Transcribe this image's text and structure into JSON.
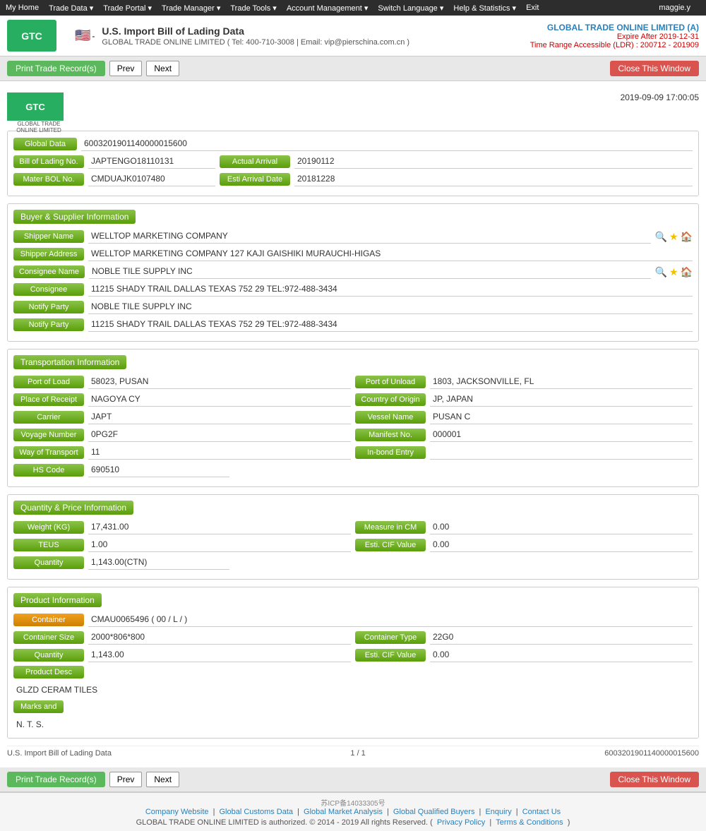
{
  "topnav": {
    "items": [
      "My Home",
      "Trade Data",
      "Trade Portal",
      "Trade Manager",
      "Trade Tools",
      "Account Management",
      "Switch Language",
      "Help & Statistics",
      "Exit"
    ],
    "user": "maggie.y"
  },
  "header": {
    "logo_text": "GTC",
    "logo_sub": "GLOBAL TRADE ONLINE LIMITED",
    "flag_emoji": "🇺🇸",
    "title": "U.S. Import Bill of Lading Data",
    "subtitle": "GLOBAL TRADE ONLINE LIMITED ( Tel: 400-710-3008 | Email: vip@pierschina.com.cn )",
    "company": "GLOBAL TRADE ONLINE LIMITED (A)",
    "expire": "Expire After 2019-12-31",
    "time_range": "Time Range Accessible (LDR) : 200712 - 201909"
  },
  "toolbar": {
    "print_label": "Print Trade Record(s)",
    "prev_label": "Prev",
    "next_label": "Next",
    "close_label": "Close This Window"
  },
  "record": {
    "timestamp": "2019-09-09 17:00:05",
    "global_data_label": "Global Data",
    "global_data_value": "6003201901140000015600",
    "bol_label": "Bill of Lading No.",
    "bol_value": "JAPTENGO18110131",
    "actual_arrival_label": "Actual Arrival",
    "actual_arrival_value": "20190112",
    "mater_bol_label": "Mater BOL No.",
    "mater_bol_value": "CMDUAJK0107480",
    "esti_arrival_label": "Esti Arrival Date",
    "esti_arrival_value": "20181228"
  },
  "buyer_supplier": {
    "section_title": "Buyer & Supplier Information",
    "shipper_name_label": "Shipper Name",
    "shipper_name_value": "WELLTOP MARKETING COMPANY",
    "shipper_address_label": "Shipper Address",
    "shipper_address_value": "WELLTOP MARKETING COMPANY 127 KAJI GAISHIKI MURAUCHI-HIGAS",
    "consignee_name_label": "Consignee Name",
    "consignee_name_value": "NOBLE TILE SUPPLY INC",
    "consignee_label": "Consignee",
    "consignee_value": "11215 SHADY TRAIL DALLAS TEXAS 752 29 TEL:972-488-3434",
    "notify_party_label": "Notify Party",
    "notify_party_value1": "NOBLE TILE SUPPLY INC",
    "notify_party_value2": "11215 SHADY TRAIL DALLAS TEXAS 752 29 TEL:972-488-3434"
  },
  "transport": {
    "section_title": "Transportation Information",
    "port_of_load_label": "Port of Load",
    "port_of_load_value": "58023, PUSAN",
    "port_of_unload_label": "Port of Unload",
    "port_of_unload_value": "1803, JACKSONVILLE, FL",
    "place_of_receipt_label": "Place of Receipt",
    "place_of_receipt_value": "NAGOYA CY",
    "country_of_origin_label": "Country of Origin",
    "country_of_origin_value": "JP, JAPAN",
    "carrier_label": "Carrier",
    "carrier_value": "JAPT",
    "vessel_name_label": "Vessel Name",
    "vessel_name_value": "PUSAN C",
    "voyage_number_label": "Voyage Number",
    "voyage_number_value": "0PG2F",
    "manifest_no_label": "Manifest No.",
    "manifest_no_value": "000001",
    "way_of_transport_label": "Way of Transport",
    "way_of_transport_value": "11",
    "in_bond_label": "In-bond Entry",
    "in_bond_value": "",
    "hs_code_label": "HS Code",
    "hs_code_value": "690510"
  },
  "quantity_price": {
    "section_title": "Quantity & Price Information",
    "weight_label": "Weight (KG)",
    "weight_value": "17,431.00",
    "measure_label": "Measure in CM",
    "measure_value": "0.00",
    "teus_label": "TEUS",
    "teus_value": "1.00",
    "esti_cif_label": "Esti. CIF Value",
    "esti_cif_value": "0.00",
    "quantity_label": "Quantity",
    "quantity_value": "1,143.00(CTN)"
  },
  "product": {
    "section_title": "Product Information",
    "container_label": "Container",
    "container_value": "CMAU0065496 ( 00 / L / )",
    "container_size_label": "Container Size",
    "container_size_value": "2000*806*800",
    "container_type_label": "Container Type",
    "container_type_value": "22G0",
    "quantity_label": "Quantity",
    "quantity_value": "1,143.00",
    "esti_cif_label": "Esti. CIF Value",
    "esti_cif_value": "0.00",
    "product_desc_label": "Product Desc",
    "product_desc_value": "GLZD CERAM TILES",
    "marks_label": "Marks and",
    "marks_value": "N. T. S."
  },
  "record_footer": {
    "left": "U.S. Import Bill of Lading Data",
    "pages": "1 / 1",
    "right": "6003201901140000015600"
  },
  "page_footer": {
    "links": [
      "Company Website",
      "Global Customs Data",
      "Global Market Analysis",
      "Global Qualified Buyers",
      "Enquiry",
      "Contact Us"
    ],
    "copyright": "GLOBAL TRADE ONLINE LIMITED is authorized. © 2014 - 2019 All rights Reserved.",
    "privacy": "Privacy Policy",
    "terms": "Terms & Conditions",
    "icp": "苏ICP备14033305号"
  },
  "colors": {
    "green_btn": "#5cb85c",
    "label_green": "#7cb342",
    "red_btn": "#d9534f",
    "orange_btn": "#f0a020"
  }
}
